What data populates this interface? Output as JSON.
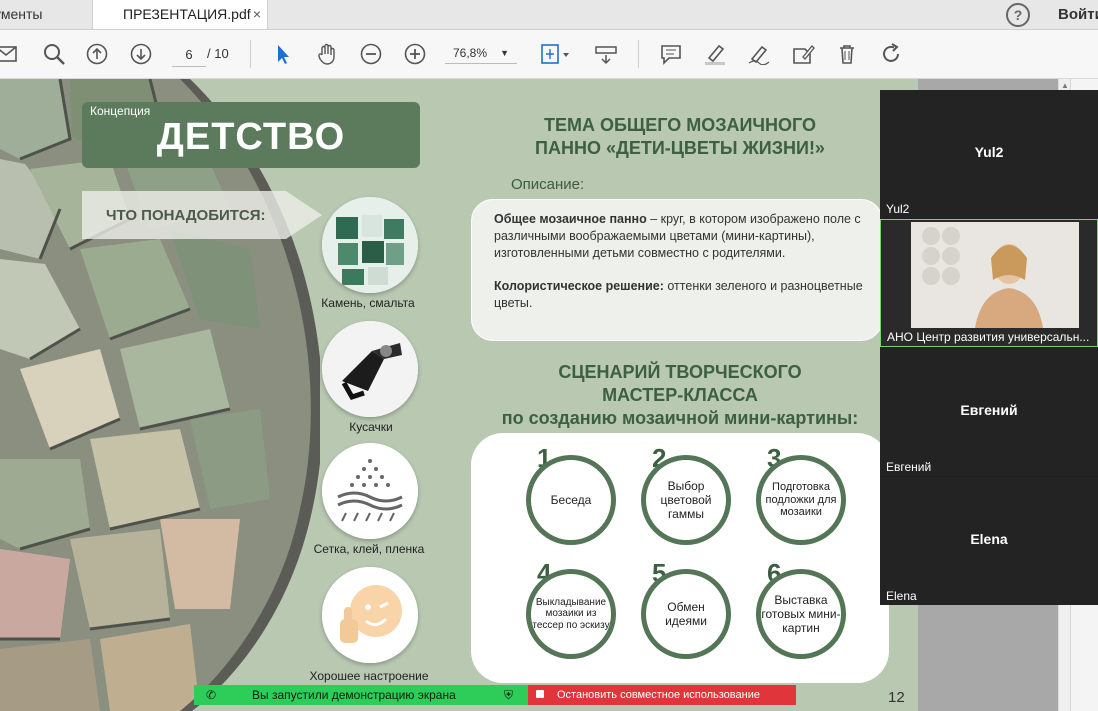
{
  "tabs": {
    "tools_label": "ументы",
    "pdf_label": "ПРЕЗЕНТАЦИЯ.pdf",
    "close": "×"
  },
  "header": {
    "help": "?",
    "signin": "Войти"
  },
  "toolbar": {
    "page_current": "6",
    "page_total": "/ 10",
    "zoom": "76,8%"
  },
  "slide": {
    "concept_label": "Концепция",
    "title": "ДЕТСТВО",
    "needs_label": "ЧТО ПОНАДОБИТСЯ:",
    "items": [
      {
        "caption": "Камень, смальта"
      },
      {
        "caption": "Кусачки"
      },
      {
        "caption": "Сетка, клей, пленка"
      },
      {
        "caption": "Хорошее настроение"
      }
    ],
    "theme_title_1": "ТЕМА ОБЩЕГО МОЗАИЧНОГО",
    "theme_title_2": "ПАННО «ДЕТИ-ЦВЕТЫ ЖИЗНИ!»",
    "description_label": "Описание:",
    "desc_bold_1": "Общее мозаичное панно",
    "desc_text_1": " – круг, в котором изображено поле с различными воображаемыми цветами (мини-картины), изготовленными детьми совместно с родителями.",
    "desc_bold_2": "Колористическое решение:",
    "desc_text_2": " оттенки зеленого и разноцветные цветы.",
    "scenario_1": "СЦЕНАРИЙ ТВОРЧЕСКОГО",
    "scenario_2": "МАСТЕР-КЛАССА",
    "scenario_3": "по созданию мозаичной мини-картины:",
    "steps": [
      {
        "num": "1",
        "label": "Беседа"
      },
      {
        "num": "2",
        "label": "Выбор цветовой гаммы"
      },
      {
        "num": "3",
        "label": "Подготовка подложки для мозаики"
      },
      {
        "num": "4",
        "label": "Выкладывание мозаики из тессер по эскизу"
      },
      {
        "num": "5",
        "label": "Обмен идеями"
      },
      {
        "num": "6",
        "label": "Выставка готовых мини-картин"
      }
    ],
    "page_number": "12"
  },
  "participants": [
    {
      "name": "Yul2",
      "label": "Yul2"
    },
    {
      "name": "",
      "label": "АНО Центр развития универсальн..."
    },
    {
      "name": "Евгений",
      "label": "Евгений"
    },
    {
      "name": "Elena",
      "label": "Elena"
    }
  ],
  "sharing": {
    "status": "Вы запустили демонстрацию экрана",
    "stop": "Остановить совместное использование"
  },
  "colors": {
    "slide_bg": "#b8c8b1",
    "accent_green": "#547556",
    "title_green": "#3d5f42",
    "share_green": "#2ecc58",
    "stop_red": "#e0353a"
  }
}
